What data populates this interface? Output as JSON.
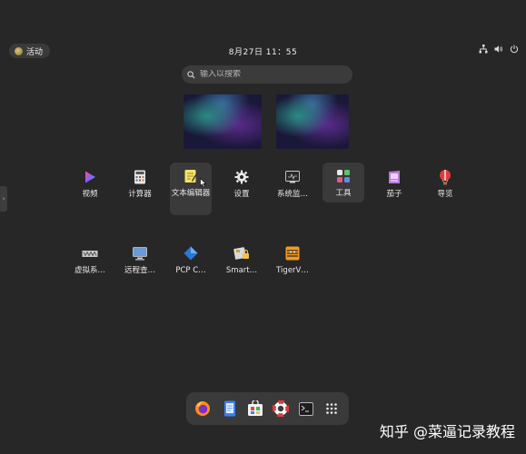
{
  "topbar": {
    "activities_label": "活动",
    "clock": "8月27日 11：55"
  },
  "search": {
    "placeholder": "输入以搜索"
  },
  "apps_row1": [
    {
      "label": "视频",
      "icon": "video-player-icon"
    },
    {
      "label": "计算器",
      "icon": "calculator-icon"
    },
    {
      "label": "文本编辑器",
      "icon": "text-editor-icon"
    },
    {
      "label": "设置",
      "icon": "gear-icon"
    },
    {
      "label": "系统监…",
      "icon": "system-monitor-icon"
    },
    {
      "label": "工具",
      "icon": "tools-folder-icon"
    },
    {
      "label": "茄子",
      "icon": "cheese-camera-icon"
    },
    {
      "label": "导览",
      "icon": "tour-balloon-icon"
    }
  ],
  "apps_row2": [
    {
      "label": "虚拟系…",
      "icon": "virtual-machine-icon"
    },
    {
      "label": "远程查…",
      "icon": "remote-viewer-icon"
    },
    {
      "label": "PCP C…",
      "icon": "pcp-charts-icon"
    },
    {
      "label": "Smart…",
      "icon": "smartcard-lock-icon"
    },
    {
      "label": "TigerV…",
      "icon": "tigervnc-icon"
    }
  ],
  "dock": [
    "firefox-icon",
    "notes-icon",
    "software-store-icon",
    "help-lifebuoy-icon",
    "terminal-icon",
    "show-apps-grid-icon"
  ],
  "watermark": "知乎 @菜逼记录教程"
}
